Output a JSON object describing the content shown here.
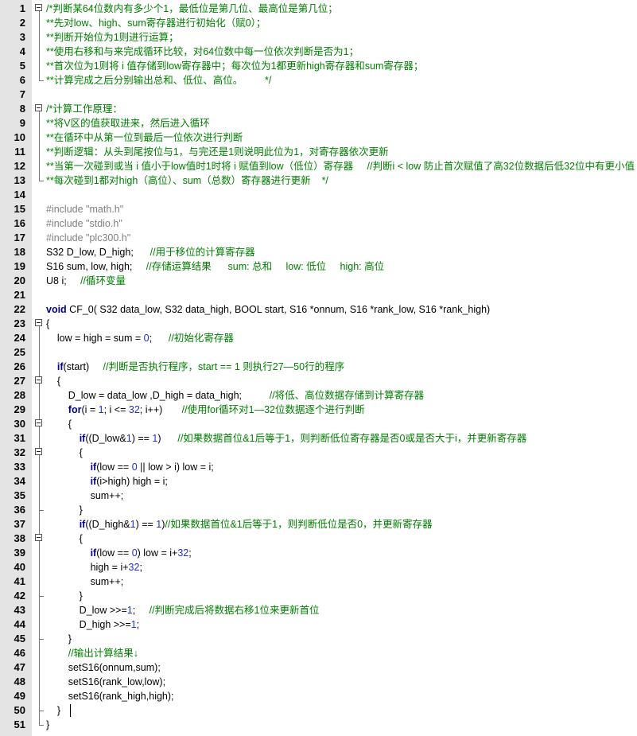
{
  "editor": {
    "lines": [
      {
        "no": "1",
        "segs": [
          {
            "t": "/*判断某64位数内有多少个1，最低位是第几位、最高位是第几位；",
            "c": "cm"
          }
        ]
      },
      {
        "no": "2",
        "segs": [
          {
            "t": "**先对low、high、sum寄存器进行初始化（赋0）；",
            "c": "cm"
          }
        ]
      },
      {
        "no": "3",
        "segs": [
          {
            "t": "**判断开始位为1则进行运算；",
            "c": "cm"
          }
        ]
      },
      {
        "no": "4",
        "segs": [
          {
            "t": "**使用右移和与来完成循环比较，对64位数中每一位依次判断是否为1；",
            "c": "cm"
          }
        ]
      },
      {
        "no": "5",
        "segs": [
          {
            "t": "**首次位为1则将 i 值存储到low寄存器中；每次位为1都更新high寄存器和sum寄存器；",
            "c": "cm"
          }
        ]
      },
      {
        "no": "6",
        "segs": [
          {
            "t": "**计算完成之后分别输出总和、低位、高位。        */",
            "c": "cm"
          }
        ]
      },
      {
        "no": "7",
        "segs": []
      },
      {
        "no": "8",
        "segs": [
          {
            "t": "/*计算工作原理：",
            "c": "cm"
          }
        ]
      },
      {
        "no": "9",
        "segs": [
          {
            "t": "**将V区的值获取进来，然后进入循环",
            "c": "cm"
          }
        ]
      },
      {
        "no": "10",
        "segs": [
          {
            "t": "**在循环中从第一位到最后一位依次进行判断",
            "c": "cm"
          }
        ]
      },
      {
        "no": "11",
        "segs": [
          {
            "t": "**判断逻辑：从头到尾按位与1，与完还是1则说明此位为1，对寄存器依次更新",
            "c": "cm"
          }
        ]
      },
      {
        "no": "12",
        "segs": [
          {
            "t": "**当第一次碰到或当 i 值小于low值时1时将 i 赋值到low（低位）寄存器     //判断i < low 防止首次赋值了高32位数据后低32位中有更小值",
            "c": "cm"
          }
        ]
      },
      {
        "no": "13",
        "segs": [
          {
            "t": "**每次碰到1都对high（高位）、sum（总数）寄存器进行更新    */",
            "c": "cm"
          }
        ]
      },
      {
        "no": "14",
        "segs": []
      },
      {
        "no": "15",
        "segs": [
          {
            "t": "#include ",
            "c": "pp"
          },
          {
            "t": "\"math.h\"",
            "c": "str"
          }
        ]
      },
      {
        "no": "16",
        "segs": [
          {
            "t": "#include ",
            "c": "pp"
          },
          {
            "t": "\"stdio.h\"",
            "c": "str"
          }
        ]
      },
      {
        "no": "17",
        "segs": [
          {
            "t": "#include ",
            "c": "pp"
          },
          {
            "t": "\"plc300.h\"",
            "c": "str"
          }
        ]
      },
      {
        "no": "18",
        "segs": [
          {
            "t": "S32 D_low, D_high;      ",
            "c": ""
          },
          {
            "t": "//用于移位的计算寄存器",
            "c": "cm"
          }
        ]
      },
      {
        "no": "19",
        "segs": [
          {
            "t": "S16 sum, low, high;     ",
            "c": ""
          },
          {
            "t": "//存储运算结果      sum: 总和     low: 低位     high: 高位",
            "c": "cm"
          }
        ]
      },
      {
        "no": "20",
        "segs": [
          {
            "t": "U8 i;     ",
            "c": ""
          },
          {
            "t": "//循环变量",
            "c": "cm"
          }
        ]
      },
      {
        "no": "21",
        "segs": []
      },
      {
        "no": "22",
        "segs": [
          {
            "t": "void",
            "c": "kw"
          },
          {
            "t": " CF_0( S32 data_low, S32 data_high, BOOL start, S16 *onnum, S16 *rank_low, S16 *rank_high)",
            "c": ""
          }
        ]
      },
      {
        "no": "23",
        "segs": [
          {
            "t": "{",
            "c": ""
          }
        ]
      },
      {
        "no": "24",
        "segs": [
          {
            "t": "    low = high = sum = ",
            "c": ""
          },
          {
            "t": "0",
            "c": "num"
          },
          {
            "t": ";      ",
            "c": ""
          },
          {
            "t": "//初始化寄存器",
            "c": "cm"
          }
        ]
      },
      {
        "no": "25",
        "segs": []
      },
      {
        "no": "26",
        "segs": [
          {
            "t": "    ",
            "c": ""
          },
          {
            "t": "if",
            "c": "kw"
          },
          {
            "t": "(start)     ",
            "c": ""
          },
          {
            "t": "//判断是否执行程序，start == 1 则执行27—50行的程序",
            "c": "cm"
          }
        ]
      },
      {
        "no": "27",
        "segs": [
          {
            "t": "    {",
            "c": ""
          }
        ]
      },
      {
        "no": "28",
        "segs": [
          {
            "t": "        D_low = data_low ,D_high = data_high;          ",
            "c": ""
          },
          {
            "t": "//将低、高位数据存储到计算寄存器",
            "c": "cm"
          }
        ]
      },
      {
        "no": "29",
        "segs": [
          {
            "t": "        ",
            "c": ""
          },
          {
            "t": "for",
            "c": "kw"
          },
          {
            "t": "(i = ",
            "c": ""
          },
          {
            "t": "1",
            "c": "num"
          },
          {
            "t": "; i <= ",
            "c": ""
          },
          {
            "t": "32",
            "c": "num"
          },
          {
            "t": "; i++)       ",
            "c": ""
          },
          {
            "t": "//使用for循环对1—32位数据逐个进行判断",
            "c": "cm"
          }
        ]
      },
      {
        "no": "30",
        "segs": [
          {
            "t": "        {",
            "c": ""
          }
        ]
      },
      {
        "no": "31",
        "segs": [
          {
            "t": "            ",
            "c": ""
          },
          {
            "t": "if",
            "c": "kw"
          },
          {
            "t": "((D_low&",
            "c": ""
          },
          {
            "t": "1",
            "c": "num"
          },
          {
            "t": ") == ",
            "c": ""
          },
          {
            "t": "1",
            "c": "num"
          },
          {
            "t": ")      ",
            "c": ""
          },
          {
            "t": "//如果数据首位&1后等于1，则判断低位寄存器是否0或是否大于i，并更新寄存器",
            "c": "cm"
          }
        ]
      },
      {
        "no": "32",
        "segs": [
          {
            "t": "            {",
            "c": ""
          }
        ]
      },
      {
        "no": "33",
        "segs": [
          {
            "t": "                ",
            "c": ""
          },
          {
            "t": "if",
            "c": "kw"
          },
          {
            "t": "(low == ",
            "c": ""
          },
          {
            "t": "0",
            "c": "num"
          },
          {
            "t": " || low > i) low = i;",
            "c": ""
          }
        ]
      },
      {
        "no": "34",
        "segs": [
          {
            "t": "                ",
            "c": ""
          },
          {
            "t": "if",
            "c": "kw"
          },
          {
            "t": "(i>high) high = i;",
            "c": ""
          }
        ]
      },
      {
        "no": "35",
        "segs": [
          {
            "t": "                sum++;",
            "c": ""
          }
        ]
      },
      {
        "no": "36",
        "segs": [
          {
            "t": "            }",
            "c": ""
          }
        ]
      },
      {
        "no": "37",
        "segs": [
          {
            "t": "            ",
            "c": ""
          },
          {
            "t": "if",
            "c": "kw"
          },
          {
            "t": "((D_high&",
            "c": ""
          },
          {
            "t": "1",
            "c": "num"
          },
          {
            "t": ") == ",
            "c": ""
          },
          {
            "t": "1",
            "c": "num"
          },
          {
            "t": ")",
            "c": ""
          },
          {
            "t": "//如果数据首位&1后等于1，则判断低位是否0，并更新寄存器",
            "c": "cm"
          }
        ]
      },
      {
        "no": "38",
        "segs": [
          {
            "t": "            {",
            "c": ""
          }
        ]
      },
      {
        "no": "39",
        "segs": [
          {
            "t": "                ",
            "c": ""
          },
          {
            "t": "if",
            "c": "kw"
          },
          {
            "t": "(low == ",
            "c": ""
          },
          {
            "t": "0",
            "c": "num"
          },
          {
            "t": ") low = i+",
            "c": ""
          },
          {
            "t": "32",
            "c": "num"
          },
          {
            "t": ";",
            "c": ""
          }
        ]
      },
      {
        "no": "40",
        "segs": [
          {
            "t": "                high = i+",
            "c": ""
          },
          {
            "t": "32",
            "c": "num"
          },
          {
            "t": ";",
            "c": ""
          }
        ]
      },
      {
        "no": "41",
        "segs": [
          {
            "t": "                sum++;",
            "c": ""
          }
        ]
      },
      {
        "no": "42",
        "segs": [
          {
            "t": "            }",
            "c": ""
          }
        ]
      },
      {
        "no": "43",
        "segs": [
          {
            "t": "            D_low >>=",
            "c": ""
          },
          {
            "t": "1",
            "c": "num"
          },
          {
            "t": ";     ",
            "c": ""
          },
          {
            "t": "//判断完成后将数据右移1位来更新首位",
            "c": "cm"
          }
        ]
      },
      {
        "no": "44",
        "segs": [
          {
            "t": "            D_high >>=",
            "c": ""
          },
          {
            "t": "1",
            "c": "num"
          },
          {
            "t": ";",
            "c": ""
          }
        ]
      },
      {
        "no": "45",
        "segs": [
          {
            "t": "        }",
            "c": ""
          }
        ]
      },
      {
        "no": "46",
        "segs": [
          {
            "t": "        ",
            "c": ""
          },
          {
            "t": "//输出计算结果↓",
            "c": "cm"
          }
        ]
      },
      {
        "no": "47",
        "segs": [
          {
            "t": "        setS16(onnum,sum);",
            "c": ""
          }
        ]
      },
      {
        "no": "48",
        "segs": [
          {
            "t": "        setS16(rank_low,low);",
            "c": ""
          }
        ]
      },
      {
        "no": "49",
        "segs": [
          {
            "t": "        setS16(rank_high,high);",
            "c": ""
          }
        ]
      },
      {
        "no": "50",
        "segs": [
          {
            "t": "    }",
            "c": ""
          }
        ]
      },
      {
        "no": "51",
        "segs": [
          {
            "t": "}",
            "c": ""
          }
        ]
      }
    ]
  },
  "colors": {
    "comment": "#008000",
    "keyword": "#00008b",
    "number": "#1e2fd6",
    "preprocessor": "#808080",
    "gutter": "#e4e4e4"
  }
}
